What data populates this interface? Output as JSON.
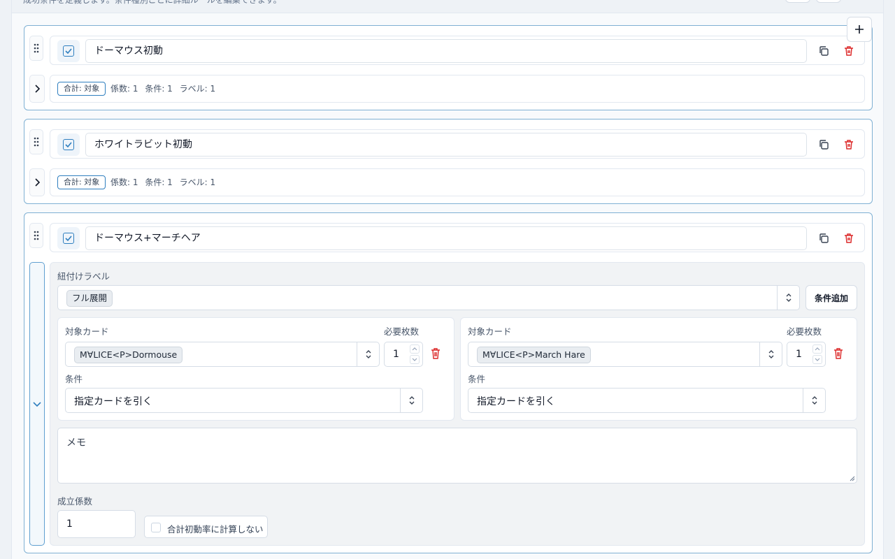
{
  "header": {
    "description": "成功条件を定義します。条件種別ごとに詳細ルールを編集できます。"
  },
  "toolbar": {
    "add_icon": "plus-icon"
  },
  "patterns": [
    {
      "enabled": true,
      "name": "ドーマウス初動",
      "badge": "合計: 対象",
      "summary": {
        "coef": "係数: 1",
        "cond": "条件: 1",
        "label": "ラベル: 1"
      }
    },
    {
      "enabled": true,
      "name": "ホワイトラビット初動",
      "badge": "合計: 対象",
      "summary": {
        "coef": "係数: 1",
        "cond": "条件: 1",
        "label": "ラベル: 1"
      }
    },
    {
      "enabled": true,
      "name": "ドーマウス+マーチヘア",
      "expanded": true,
      "detail": {
        "label_title": "紐付けラベル",
        "selected_label": "フル展開",
        "add_condition_label": "条件追加",
        "conditions": [
          {
            "card_label": "対象カード",
            "card": "M∀LICE<P>Dormouse",
            "count_label": "必要枚数",
            "count": "1",
            "cond_label": "条件",
            "cond": "指定カードを引く"
          },
          {
            "card_label": "対象カード",
            "card": "M∀LICE<P>March Hare",
            "count_label": "必要枚数",
            "count": "1",
            "cond_label": "条件",
            "cond": "指定カードを引く"
          }
        ],
        "memo_placeholder": "メモ",
        "factor_label": "成立係数",
        "factor_value": "1",
        "exclude_label": "合計初動率に計算しない"
      }
    }
  ],
  "colors": {
    "accent": "#2f7fbf",
    "danger": "#dc2626",
    "border_active": "#7fb0d3"
  }
}
